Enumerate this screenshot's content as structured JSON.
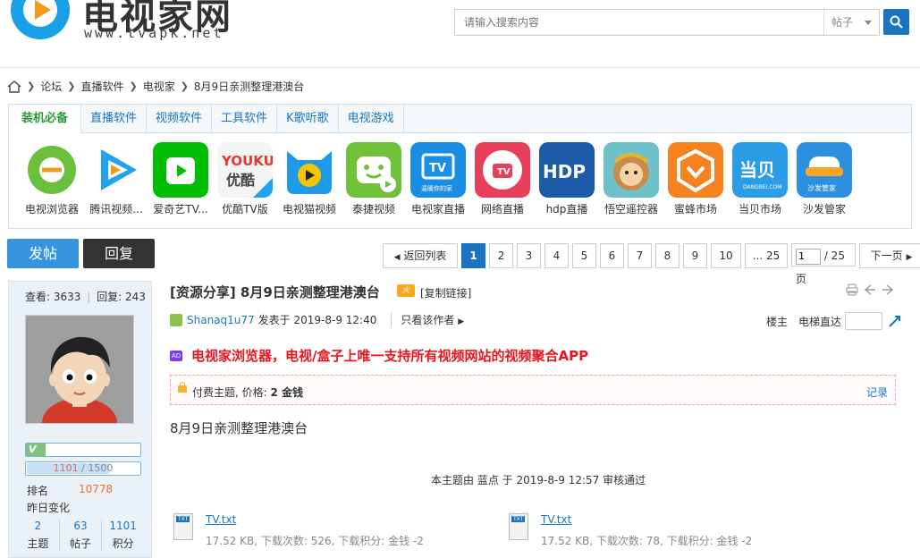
{
  "header": {
    "logo_title": "电视家网",
    "logo_url": "www.tvapk.net",
    "search_placeholder": "请输入搜索内容",
    "search_scope": "帖子"
  },
  "breadcrumb": {
    "items": [
      "论坛",
      "直播软件",
      "电视家",
      "8月9日亲测整理港澳台"
    ]
  },
  "tabs": [
    "装机必备",
    "直播软件",
    "视频软件",
    "工具软件",
    "K歌听歌",
    "电视游戏"
  ],
  "apps": [
    {
      "label": "电视浏览器",
      "color": "#6abf3b"
    },
    {
      "label": "腾讯视频...",
      "color": "#1fa3f0"
    },
    {
      "label": "爱奇艺TV...",
      "color": "#00be06"
    },
    {
      "label": "优酷TV版",
      "color": "#f8f8f8"
    },
    {
      "label": "电视猫视频",
      "color": "#1e9be8"
    },
    {
      "label": "泰捷视频",
      "color": "#71c23b"
    },
    {
      "label": "电视家直播",
      "color": "#1a8ee0"
    },
    {
      "label": "网络直播",
      "color": "#e8405a"
    },
    {
      "label": "hdp直播",
      "color": "#1d5aa8"
    },
    {
      "label": "悟空遥控器",
      "color": "#6ec1c8"
    },
    {
      "label": "蜜蜂市场",
      "color": "#f5821f"
    },
    {
      "label": "当贝市场",
      "color": "#2a9de6"
    },
    {
      "label": "沙发管家",
      "color": "#2c8fe0"
    }
  ],
  "actions": {
    "post": "发帖",
    "reply": "回复"
  },
  "pager": {
    "back": "返回列表",
    "pages": [
      "1",
      "2",
      "3",
      "4",
      "5",
      "6",
      "7",
      "8",
      "9",
      "10",
      "... 25"
    ],
    "current_input": "1",
    "total": "/ 25 页",
    "next": "下一页"
  },
  "user": {
    "views_label": "查看:",
    "views": "3633",
    "replies_label": "回复:",
    "replies": "243",
    "level_badge": "V",
    "points_current": "1101",
    "points_total": "1500",
    "points_fraction": 0.734,
    "rank_label": "排名",
    "rank": "10778",
    "daily_change": "昨日变化",
    "counters": [
      {
        "n": "2",
        "l": "主题"
      },
      {
        "n": "63",
        "l": "帖子"
      },
      {
        "n": "1101",
        "l": "积分"
      }
    ]
  },
  "post": {
    "title": "[资源分享] 8月9日亲测整理港澳台",
    "hot_badge": "火",
    "copy_link": "[复制链接]",
    "author": "Shanaq1u77",
    "posted_at": "发表于 2019-8-9 12:40",
    "only_author": "只看该作者",
    "floor": "楼主",
    "elevator": "电梯直达",
    "promo_badge": "AD",
    "promo_text": "电视家浏览器，电视/盒子上唯一支持所有视频网站的视频聚合APP",
    "paid_text_prefix": "付费主题, 价格:",
    "paid_price": "2 金钱",
    "paid_record": "记录",
    "body": "8月9日亲测整理港澳台",
    "audit": "本主题由 蓝点 于 2019-8-9 12:57 审核通过"
  },
  "attachments": [
    {
      "name": "TV.txt",
      "meta": "17.52 KB, 下载次数: 526, 下载积分: 金钱 -2"
    },
    {
      "name": "TV.txt",
      "meta": "17.52 KB, 下载次数: 78, 下载积分: 金钱 -2"
    }
  ]
}
